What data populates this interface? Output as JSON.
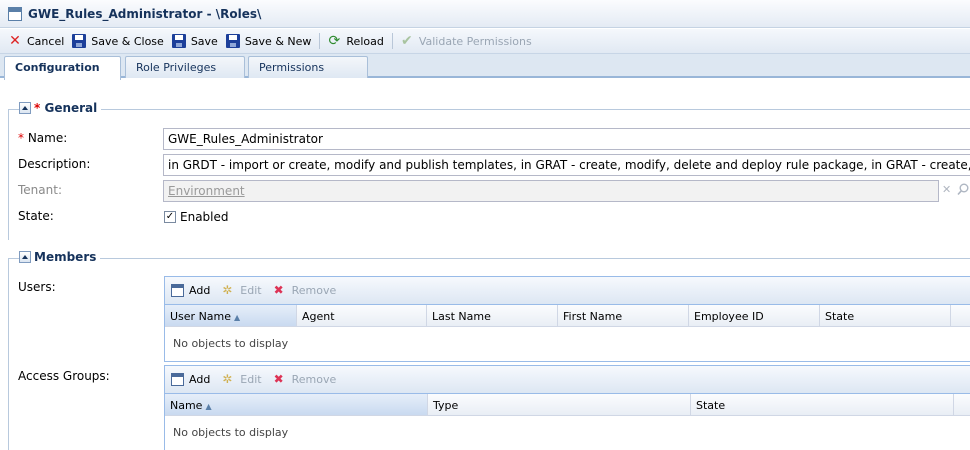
{
  "window": {
    "title": "GWE_Rules_Administrator - \\Roles\\"
  },
  "toolbar": {
    "cancel": "Cancel",
    "save_close": "Save & Close",
    "save": "Save",
    "save_new": "Save & New",
    "reload": "Reload",
    "validate": "Validate Permissions"
  },
  "tabs": [
    {
      "label": "Configuration",
      "active": true
    },
    {
      "label": "Role Privileges",
      "active": false
    },
    {
      "label": "Permissions",
      "active": false
    }
  ],
  "general": {
    "title": "General",
    "required_mark": "*",
    "name_label": "Name:",
    "name_value": "GWE_Rules_Administrator",
    "description_label": "Description:",
    "description_value": "in GRDT - import or create, modify and publish templates, in GRAT - create, modify, delete and deploy rule package,  in GRAT - create, modify, delete",
    "tenant_label": "Tenant:",
    "tenant_value": "Environment",
    "state_label": "State:",
    "state_value": "Enabled",
    "state_checked": true
  },
  "members": {
    "title": "Members",
    "users_label": "Users:",
    "access_groups_label": "Access Groups:",
    "grid_buttons": {
      "add": "Add",
      "edit": "Edit",
      "remove": "Remove"
    },
    "users_columns": [
      "User Name",
      "Agent",
      "Last Name",
      "First Name",
      "Employee ID",
      "State"
    ],
    "groups_columns": [
      "Name",
      "Type",
      "State"
    ],
    "empty_text": "No objects to display"
  },
  "icons": {
    "cancel": "x-icon",
    "save": "floppy-disk-icon",
    "reload": "reload-icon",
    "validate": "check-circle-icon",
    "clear": "clear-icon",
    "search": "search-icon"
  },
  "colors": {
    "accent": "#15325b",
    "required": "#dd0000"
  }
}
